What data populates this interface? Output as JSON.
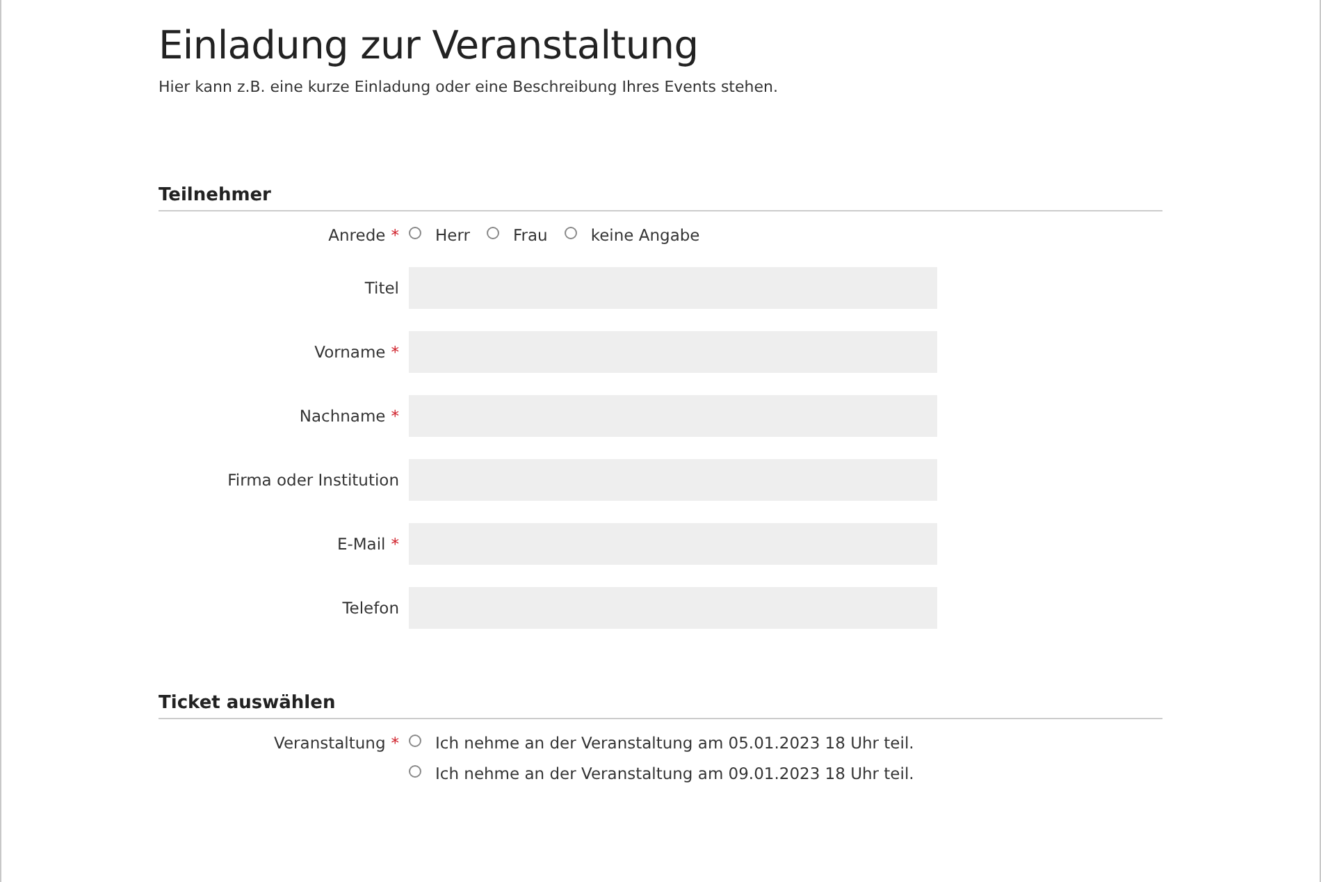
{
  "title": "Einladung zur Veranstaltung",
  "description": "Hier kann z.B. eine kurze Einladung oder eine Beschreibung Ihres Events stehen.",
  "sections": [
    {
      "heading": "Teilnehmer",
      "fields": [
        {
          "kind": "radio-row",
          "label": "Anrede",
          "required_mark": "*",
          "options": [
            {
              "label": "Herr",
              "selected": false
            },
            {
              "label": "Frau",
              "selected": false
            },
            {
              "label": "keine Angabe",
              "selected": false
            }
          ]
        },
        {
          "kind": "text",
          "label": "Titel"
        },
        {
          "kind": "text",
          "label": "Vorname",
          "required_mark": "*"
        },
        {
          "kind": "text",
          "label": "Nachname",
          "required_mark": "*"
        },
        {
          "kind": "text",
          "label": "Firma oder Institution"
        },
        {
          "kind": "text",
          "label": "E-Mail",
          "required_mark": "*"
        },
        {
          "kind": "text",
          "label": "Telefon"
        }
      ]
    },
    {
      "heading": "Ticket auswählen",
      "fields": [
        {
          "kind": "radio-list",
          "label": "Veranstaltung",
          "required_mark": "*",
          "options": [
            {
              "label": "Ich nehme an der Veranstaltung am 05.01.2023 18 Uhr teil.",
              "selected": false
            },
            {
              "label": "Ich nehme an der Veranstaltung am 09.01.2023 18 Uhr teil.",
              "selected": false
            }
          ]
        }
      ]
    }
  ]
}
